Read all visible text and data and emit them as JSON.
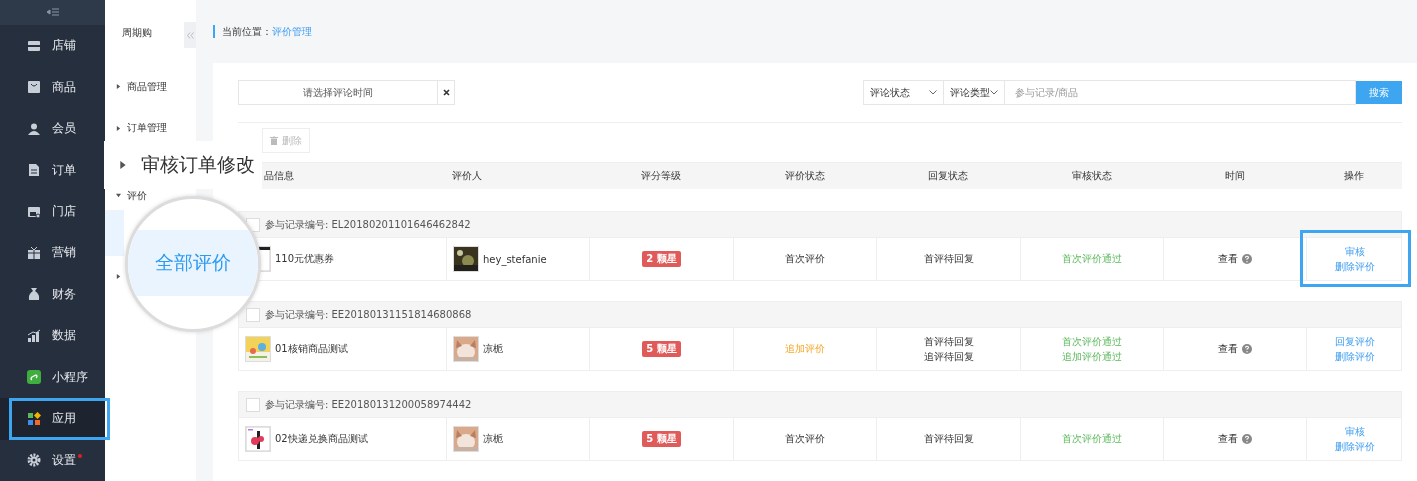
{
  "sidebar": {
    "items": [
      {
        "label": "店铺",
        "selected": false,
        "highlighted": false,
        "badge": false
      },
      {
        "label": "商品",
        "selected": false,
        "highlighted": false,
        "badge": false
      },
      {
        "label": "会员",
        "selected": false,
        "highlighted": false,
        "badge": false
      },
      {
        "label": "订单",
        "selected": false,
        "highlighted": false,
        "badge": false
      },
      {
        "label": "门店",
        "selected": false,
        "highlighted": false,
        "badge": false
      },
      {
        "label": "营销",
        "selected": false,
        "highlighted": false,
        "badge": false
      },
      {
        "label": "财务",
        "selected": false,
        "highlighted": false,
        "badge": false
      },
      {
        "label": "数据",
        "selected": false,
        "highlighted": false,
        "badge": false
      },
      {
        "label": "小程序",
        "selected": false,
        "highlighted": false,
        "badge": false
      },
      {
        "label": "应用",
        "selected": true,
        "highlighted": true,
        "badge": false
      },
      {
        "label": "设置",
        "selected": false,
        "highlighted": false,
        "badge": true
      }
    ]
  },
  "subnav": {
    "title": "周期购",
    "items": [
      {
        "label": "商品管理",
        "expanded": false,
        "zoomed": false
      },
      {
        "label": "订单管理",
        "expanded": false,
        "zoomed": false
      },
      {
        "label": "审核订单修改",
        "expanded": false,
        "zoomed": true
      },
      {
        "label": "评价",
        "expanded": true,
        "zoomed": false,
        "children": [
          {
            "label": "全部评价",
            "selected": true,
            "magnified": true
          }
        ]
      },
      {
        "expanded": false,
        "zoomed": false
      }
    ]
  },
  "breadcrumb": {
    "prefix": "当前位置：",
    "current": "评价管理"
  },
  "filters": {
    "date_placeholder": "请选择评论时间",
    "selects": [
      "评论状态",
      "评论类型"
    ],
    "search_placeholder": "参与记录/商品",
    "search_button": "搜索"
  },
  "toolbar": {
    "delete_button": "删除"
  },
  "table": {
    "columns": [
      "品信息",
      "评价人",
      "评分等级",
      "评价状态",
      "回复状态",
      "审核状态",
      "时间",
      "操作"
    ],
    "groups": [
      {
        "record": "参与记录编号: EL20180201101646462842",
        "checked": false,
        "product": "110元优惠券",
        "reviewer": "hey_stefanie",
        "rating": "2 颗星",
        "review_status": "首次评价",
        "kind": "first",
        "reply_status": [
          "首评待回复"
        ],
        "audit_status": [
          "首次评价通过"
        ],
        "time": "查看",
        "actions": [
          "审核",
          "删除评价"
        ],
        "highlighted": true
      },
      {
        "record": "参与记录编号: EE20180131151814680868",
        "checked": false,
        "product": "01核销商品测试",
        "reviewer": "凉栀",
        "rating": "5 颗星",
        "review_status": "追加评价",
        "kind": "append",
        "reply_status": [
          "首评待回复",
          "追评待回复"
        ],
        "audit_status": [
          "首次评价通过",
          "追加评价通过"
        ],
        "time": "查看",
        "actions": [
          "回复评价",
          "删除评价"
        ],
        "highlighted": false
      },
      {
        "record": "参与记录编号: EE20180131200058974442",
        "checked": false,
        "product": "02快递兑换商品测试",
        "reviewer": "凉栀",
        "rating": "5 颗星",
        "review_status": "首次评价",
        "kind": "first",
        "reply_status": [
          "首评待回复"
        ],
        "audit_status": [
          "首次评价通过"
        ],
        "time": "查看",
        "actions": [
          "审核",
          "删除评价"
        ],
        "highlighted": false
      }
    ]
  }
}
